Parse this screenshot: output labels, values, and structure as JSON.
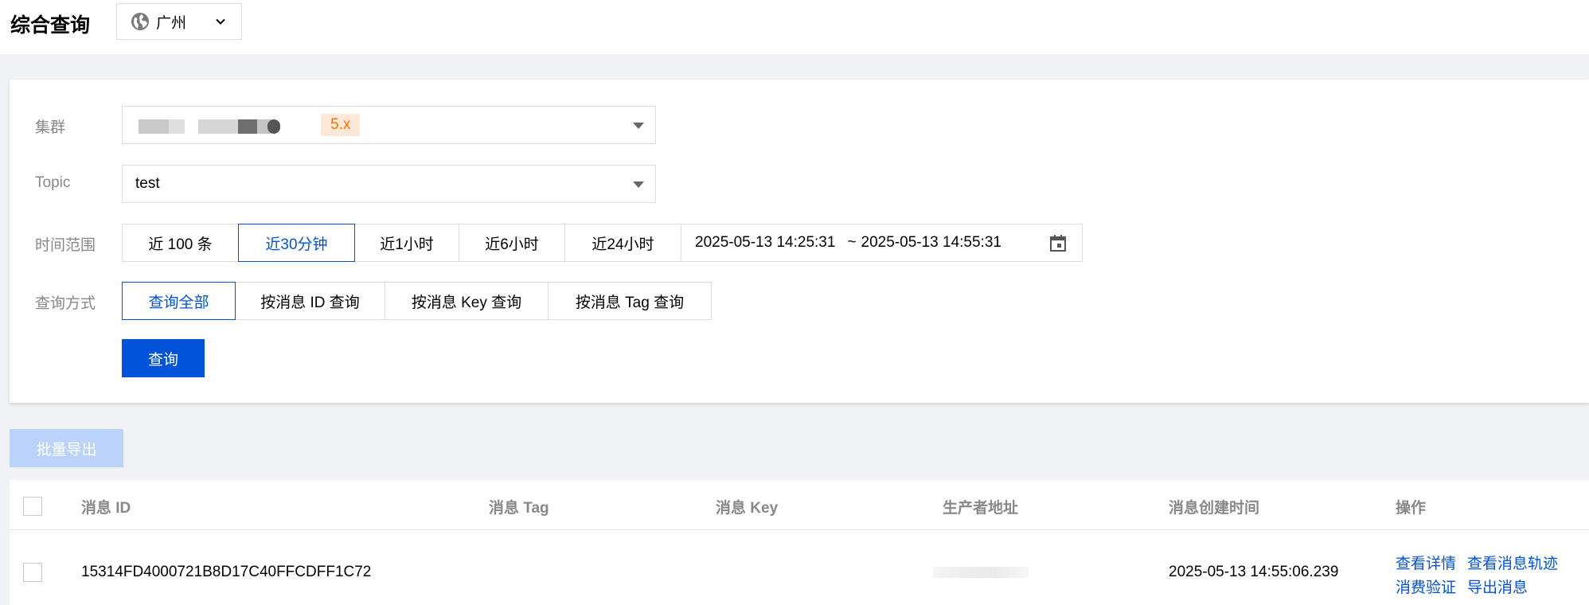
{
  "header": {
    "title": "综合查询",
    "region": "广州"
  },
  "form": {
    "cluster": {
      "label": "集群",
      "version_badge": "5.x"
    },
    "topic": {
      "label": "Topic",
      "value": "test"
    },
    "time_range": {
      "label": "时间范围",
      "options": [
        "近 100 条",
        "近30分钟",
        "近1小时",
        "近6小时",
        "近24小时"
      ],
      "selected": "近30分钟",
      "start": "2025-05-13 14:25:31",
      "separator": "~",
      "end": "2025-05-13 14:55:31"
    },
    "query_mode": {
      "label": "查询方式",
      "options": [
        "查询全部",
        "按消息 ID 查询",
        "按消息 Key 查询",
        "按消息 Tag 查询"
      ],
      "selected": "查询全部"
    },
    "query_button": "查询"
  },
  "batch_export_button": "批量导出",
  "table": {
    "columns": [
      "消息 ID",
      "消息 Tag",
      "消息 Key",
      "生产者地址",
      "消息创建时间",
      "操作"
    ],
    "rows": [
      {
        "message_id": "15314FD4000721B8D17C40FFCDFF1C72",
        "tag": "",
        "key": "",
        "created_at": "2025-05-13 14:55:06.239",
        "actions": [
          "查看详情",
          "查看消息轨迹",
          "消费验证",
          "导出消息"
        ]
      }
    ]
  },
  "colors": {
    "primary": "#0052d9",
    "badge_bg": "#fde8d7",
    "badge_text": "#ff7200",
    "disabled_btn": "#bbd3fb"
  }
}
